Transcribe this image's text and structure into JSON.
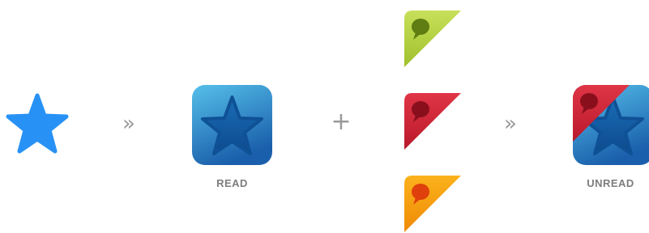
{
  "step_one": {
    "icon": "star-icon",
    "color": "#2891f5"
  },
  "separators": {
    "arrow_1": "»",
    "plus": "+",
    "arrow_2": "»"
  },
  "read_icon": {
    "icon": "app-star-icon",
    "label": "READ",
    "color": "#2b8fd4"
  },
  "badges": [
    {
      "icon": "speech-bubble-corner-icon",
      "color": "#b6d43c"
    },
    {
      "icon": "speech-bubble-corner-icon",
      "color": "#d62a3c"
    },
    {
      "icon": "speech-bubble-corner-icon",
      "color": "#f59a10"
    }
  ],
  "unread_icon": {
    "icon": "app-star-with-badge-icon",
    "label": "UNREAD"
  }
}
